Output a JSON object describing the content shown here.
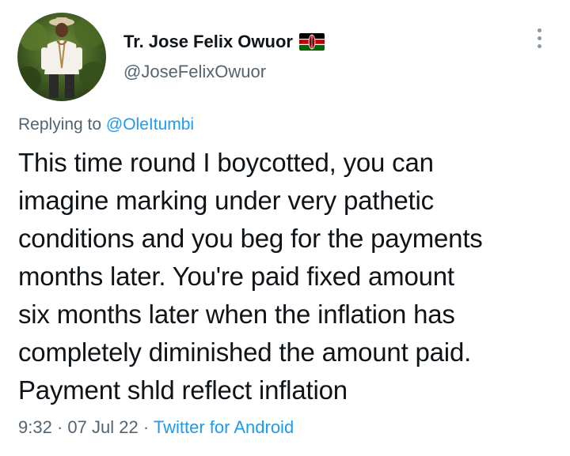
{
  "author": {
    "display_name": "Tr. Jose Felix Owuor",
    "handle": "@JoseFelixOwuor",
    "flag_icon": "kenya-flag-icon"
  },
  "reply": {
    "prefix": "Replying to",
    "mention": "@OleItumbi"
  },
  "tweet": {
    "lines": [
      "This time round I boycotted, you can",
      "imagine marking under very pathetic",
      "conditions and you beg for the payments",
      "months later. You're paid fixed amount",
      "six months later when the inflation has",
      "completely diminished the amount paid.",
      "Payment shld reflect inflation"
    ]
  },
  "meta": {
    "time": "9:32",
    "sep1": "·",
    "date": "07 Jul 22",
    "sep2": "·",
    "source": "Twitter for Android"
  },
  "colors": {
    "text": "#0f1419",
    "secondary": "#536471",
    "link": "#1d9bf0"
  }
}
